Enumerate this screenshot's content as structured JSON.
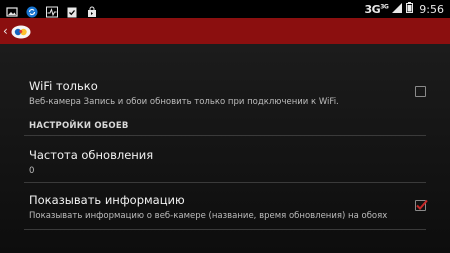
{
  "status_bar": {
    "left_icons": [
      "image-icon",
      "sync-icon",
      "activity-icon",
      "clipboard-check-icon",
      "shopping-bag-icon"
    ],
    "network": "3G",
    "network_sup": "3G",
    "time": "9:56"
  },
  "app_bar": {
    "back_icon": "chevron-left-icon",
    "logo_icon": "app-logo-icon"
  },
  "preferences": {
    "wifi_only": {
      "title": "WiFi только",
      "summary": "Веб-камера Запись и обои обновить только при подключении к WiFi.",
      "checked": false
    },
    "section_header": "НАСТРОЙКИ ОБОЕВ",
    "update_frequency": {
      "title": "Частота обновления",
      "value": "0"
    },
    "show_info": {
      "title": "Показывать информацию",
      "summary": "Показывать информацию о веб-камере (название, время обновления) на обоях",
      "checked": true
    }
  },
  "colors": {
    "app_bar": "#8b0f0f",
    "checkmark": "#c62828",
    "background": "#141414"
  }
}
